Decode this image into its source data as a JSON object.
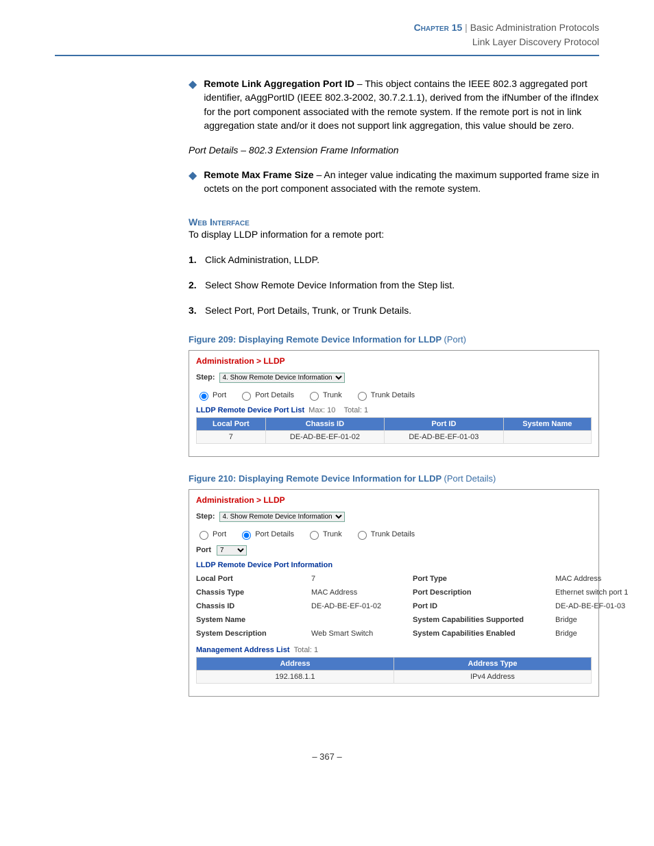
{
  "header": {
    "chapter": "Chapter 15",
    "sep": "|",
    "title": "Basic Administration Protocols",
    "subtitle": "Link Layer Discovery Protocol"
  },
  "bullets": {
    "b1_title": "Remote Link Aggregation Port ID",
    "b1_text": " – This object contains the IEEE 802.3 aggregated port identifier, aAggPortID (IEEE 802.3-2002, 30.7.2.1.1), derived from the ifNumber of the ifIndex for the port component associated with the remote system. If the remote port is not in link aggregation state and/or it does not support link aggregation, this value should be zero.",
    "b2_title": "Remote Max Frame Size",
    "b2_text": " – An integer value indicating the maximum supported frame size in octets on the port component associated with the remote system."
  },
  "section_italic": "Port Details – 802.3 Extension Frame Information",
  "web_interface": "Web Interface",
  "intro": "To display LLDP information for a remote port:",
  "steps": {
    "s1": "Click Administration, LLDP.",
    "s2": "Select Show Remote Device Information from the Step list.",
    "s3": "Select Port, Port Details, Trunk, or Trunk Details."
  },
  "fig209": {
    "caption": "Figure 209:  Displaying Remote Device Information for LLDP",
    "suffix": "(Port)",
    "breadcrumb": "Administration > LLDP",
    "step_label": "Step:",
    "step_value": "4. Show Remote Device Information",
    "radios": {
      "port": "Port",
      "port_details": "Port Details",
      "trunk": "Trunk",
      "trunk_details": "Trunk Details"
    },
    "list_title": "LLDP Remote Device Port List",
    "max_label": "Max: 10",
    "total_label": "Total: 1",
    "cols": {
      "c1": "Local Port",
      "c2": "Chassis ID",
      "c3": "Port ID",
      "c4": "System Name"
    },
    "row": {
      "c1": "7",
      "c2": "DE-AD-BE-EF-01-02",
      "c3": "DE-AD-BE-EF-01-03",
      "c4": ""
    }
  },
  "fig210": {
    "caption": "Figure 210:  Displaying Remote Device Information for LLDP",
    "suffix": "(Port Details)",
    "breadcrumb": "Administration > LLDP",
    "step_label": "Step:",
    "step_value": "4. Show Remote Device Information",
    "radios": {
      "port": "Port",
      "port_details": "Port Details",
      "trunk": "Trunk",
      "trunk_details": "Trunk Details"
    },
    "port_label": "Port",
    "port_value": "7",
    "info_title": "LLDP Remote Device Port Information",
    "fields": {
      "local_port_k": "Local Port",
      "local_port_v": "7",
      "port_type_k": "Port Type",
      "port_type_v": "MAC Address",
      "chassis_type_k": "Chassis Type",
      "chassis_type_v": "MAC Address",
      "port_desc_k": "Port Description",
      "port_desc_v": "Ethernet switch port 1",
      "chassis_id_k": "Chassis ID",
      "chassis_id_v": "DE-AD-BE-EF-01-02",
      "port_id_k": "Port ID",
      "port_id_v": "DE-AD-BE-EF-01-03",
      "sys_name_k": "System Name",
      "sys_name_v": "",
      "sys_cap_sup_k": "System Capabilities Supported",
      "sys_cap_sup_v": "Bridge",
      "sys_desc_k": "System Description",
      "sys_desc_v": "Web Smart Switch",
      "sys_cap_en_k": "System Capabilities Enabled",
      "sys_cap_en_v": "Bridge"
    },
    "mgmt_title": "Management Address List",
    "mgmt_total": "Total: 1",
    "mgmt_cols": {
      "c1": "Address",
      "c2": "Address Type"
    },
    "mgmt_row": {
      "c1": "192.168.1.1",
      "c2": "IPv4 Address"
    }
  },
  "pagenum": "–  367  –"
}
